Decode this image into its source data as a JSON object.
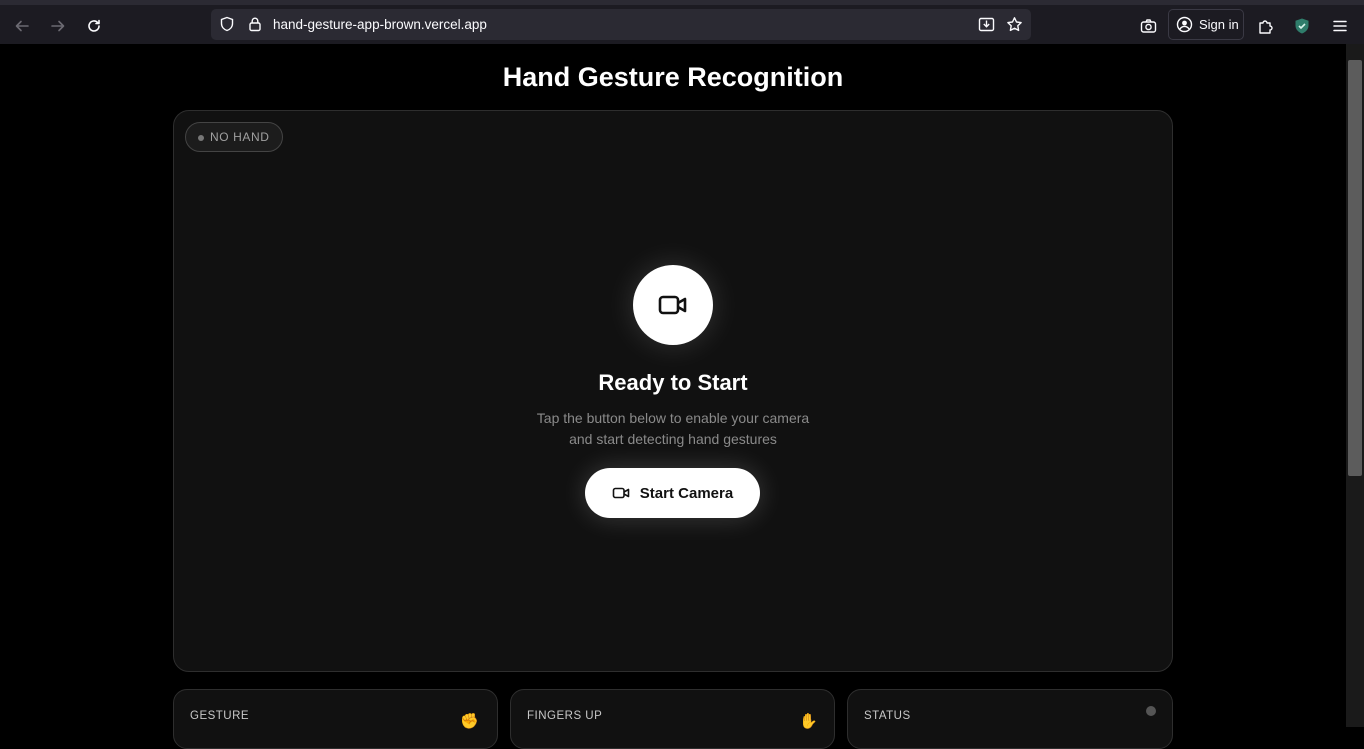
{
  "browser": {
    "url": "hand-gesture-app-brown.vercel.app",
    "signin_label": "Sign in"
  },
  "page": {
    "title": "Hand Gesture Recognition"
  },
  "camera_panel": {
    "hand_status": "NO HAND",
    "ready_title": "Ready to Start",
    "description_line1": "Tap the button below to enable your camera",
    "description_line2": "and start detecting hand gestures",
    "start_button_label": "Start Camera"
  },
  "stats": [
    {
      "label": "GESTURE",
      "icon": "✊"
    },
    {
      "label": "FINGERS UP",
      "icon": "✋"
    },
    {
      "label": "STATUS",
      "icon": "status-dot"
    }
  ]
}
